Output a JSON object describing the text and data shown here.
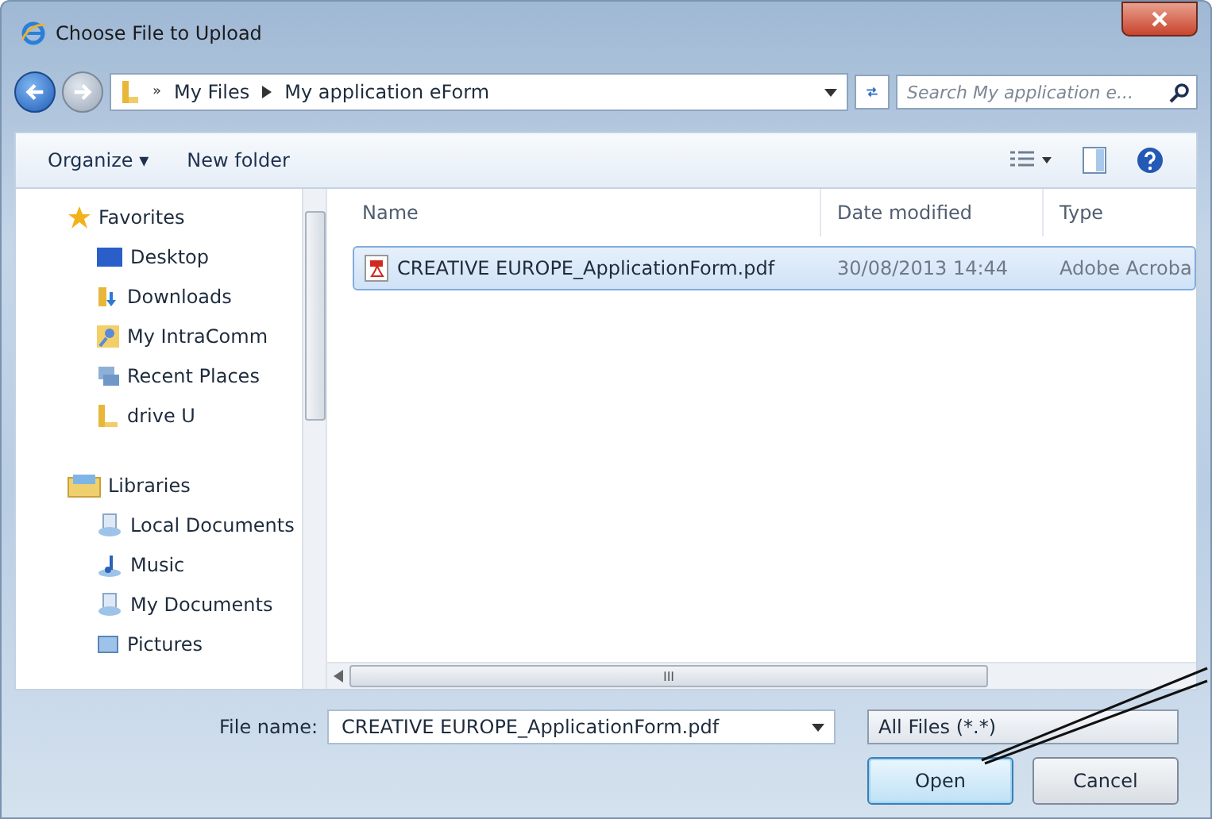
{
  "window": {
    "title": "Choose File to Upload"
  },
  "address_bar": {
    "overflow": "»",
    "path": [
      "My Files",
      "My application eForm"
    ]
  },
  "search": {
    "placeholder": "Search My application e..."
  },
  "toolbar": {
    "items": [
      "Organize ▾",
      "New folder"
    ]
  },
  "navigation": {
    "groups": [
      {
        "label": "Favorites",
        "kind": "star",
        "children": [
          {
            "label": "Desktop",
            "kind": "desktop"
          },
          {
            "label": "Downloads",
            "kind": "downloads"
          },
          {
            "label": "My IntraComm",
            "kind": "user"
          },
          {
            "label": "Recent Places",
            "kind": "recent"
          },
          {
            "label": "drive U",
            "kind": "folder"
          }
        ]
      },
      {
        "label": "Libraries",
        "kind": "library",
        "children": [
          {
            "label": "Local Documents",
            "kind": "docs"
          },
          {
            "label": "Music",
            "kind": "music"
          },
          {
            "label": "My Documents",
            "kind": "docs"
          },
          {
            "label": "Pictures",
            "kind": "pictures"
          }
        ]
      }
    ]
  },
  "table": {
    "columns": [
      "Name",
      "Date modified",
      "Type"
    ],
    "rows": [
      {
        "name": "CREATIVE EUROPE_ApplicationForm.pdf",
        "date": "30/08/2013 14:44",
        "type": "Adobe Acroba",
        "selected": true
      }
    ]
  },
  "scrollbar_grip": "III",
  "file_name": {
    "label": "File name:",
    "value": "CREATIVE EUROPE_ApplicationForm.pdf"
  },
  "file_type": {
    "value": "All Files (*.*)"
  },
  "buttons": [
    {
      "label": "Open",
      "selected": true
    },
    {
      "label": "Cancel",
      "selected": false
    }
  ]
}
